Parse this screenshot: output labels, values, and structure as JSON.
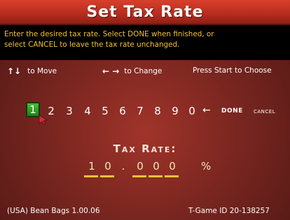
{
  "title": "Set Tax Rate",
  "instructions": {
    "line1": "Enter the desired tax rate.  Select DONE when finished, or",
    "line2": "select CANCEL to leave the tax rate unchanged."
  },
  "hints": {
    "move_arrows": "↑↓",
    "move_text": "to Move",
    "change_arrows": "← →",
    "change_text": "to Change",
    "start_text": "Press Start to Choose"
  },
  "keypad": {
    "digits": [
      "1",
      "2",
      "3",
      "4",
      "5",
      "6",
      "7",
      "8",
      "9",
      "0"
    ],
    "selected_digit": "1",
    "backspace_icon": "left-arrow-icon",
    "backspace_glyph": "←",
    "done_label": "DONE",
    "cancel_label": "CANCEL"
  },
  "tax_rate": {
    "label": "Tax Rate:",
    "integer_digits": [
      "1",
      "0"
    ],
    "decimal_point": ".",
    "fraction_digits": [
      "0",
      "0",
      "0"
    ],
    "unit": "%"
  },
  "footer": {
    "left": "(USA) Bean Bags 1.00.06",
    "right": "T-Game ID 20-138257"
  },
  "colors": {
    "title_bar": "#c2321f",
    "background": "#7a2620",
    "instruction_text": "#f3c12c",
    "selected_key": "#3aa02c",
    "underline": "#e8c43a"
  }
}
